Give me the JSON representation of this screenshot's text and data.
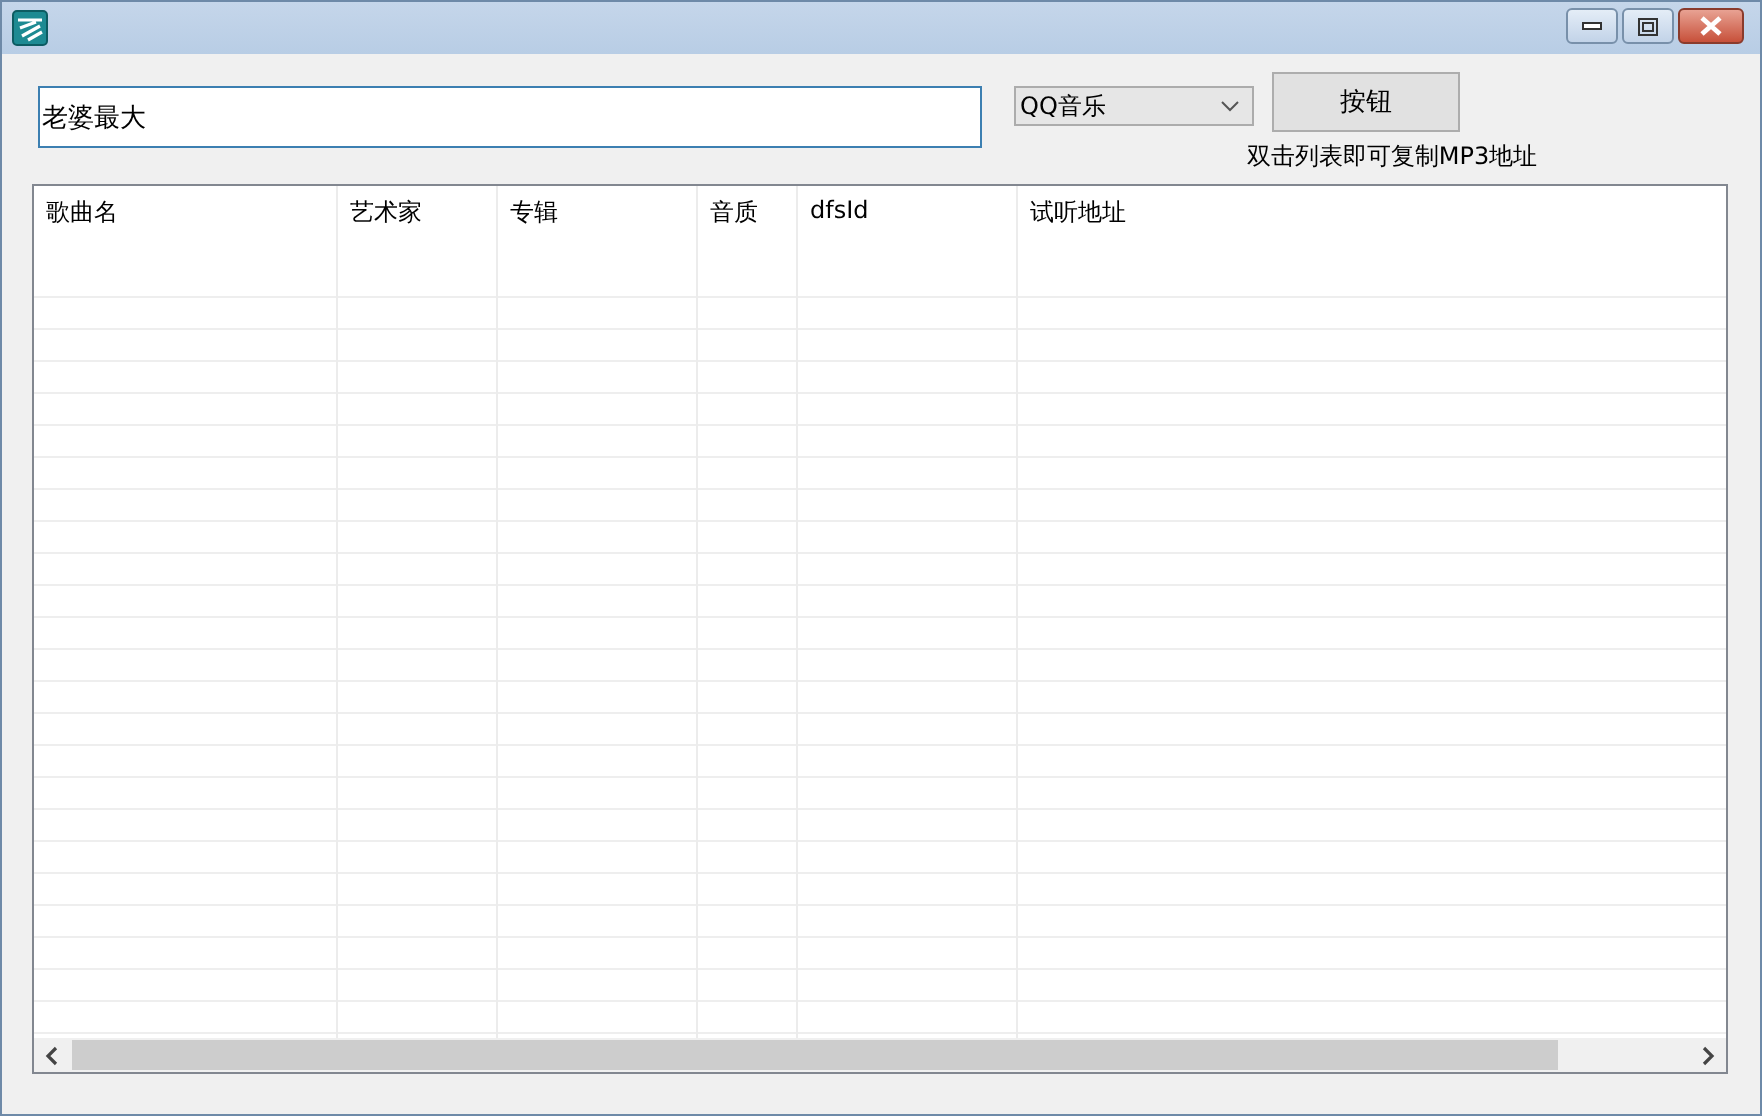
{
  "search": {
    "value": "老婆最大"
  },
  "source_select": {
    "value": "QQ音乐"
  },
  "button": {
    "label": "按钮"
  },
  "hint": "双击列表即可复制MP3地址",
  "table": {
    "columns": [
      "歌曲名",
      "艺术家",
      "专辑",
      "音质",
      "dfsId",
      "试听地址"
    ]
  }
}
